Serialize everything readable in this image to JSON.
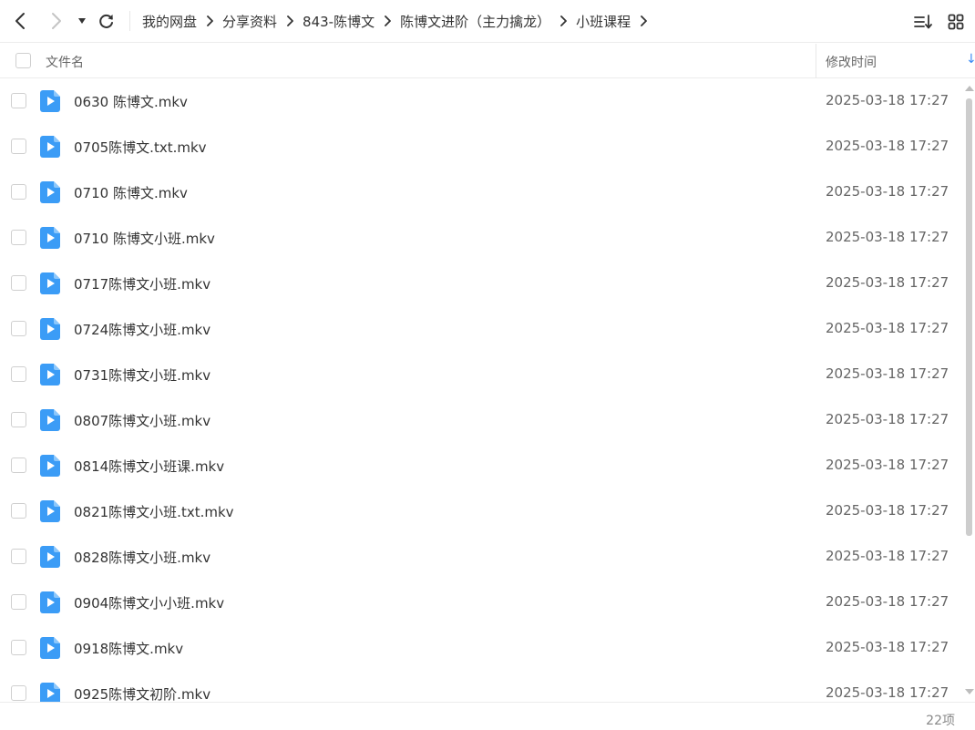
{
  "toolbar": {
    "back_icon": "chevron-left-icon",
    "forward_icon": "chevron-right-icon",
    "dropdown_icon": "caret-down-icon",
    "refresh_icon": "refresh-icon",
    "sort_icon": "sort-icon",
    "grid_icon": "grid-view-icon"
  },
  "breadcrumb": [
    "我的网盘",
    "分享资料",
    "843-陈博文",
    "陈博文进阶（主力擒龙）",
    "小班课程"
  ],
  "header": {
    "name_label": "文件名",
    "time_label": "修改时间",
    "sort_arrow": "↓"
  },
  "files": [
    {
      "name": "0630 陈博文.mkv",
      "time": "2025-03-18 17:27"
    },
    {
      "name": "0705陈博文.txt.mkv",
      "time": "2025-03-18 17:27"
    },
    {
      "name": "0710 陈博文.mkv",
      "time": "2025-03-18 17:27"
    },
    {
      "name": "0710 陈博文小班.mkv",
      "time": "2025-03-18 17:27"
    },
    {
      "name": "0717陈博文小班.mkv",
      "time": "2025-03-18 17:27"
    },
    {
      "name": "0724陈博文小班.mkv",
      "time": "2025-03-18 17:27"
    },
    {
      "name": "0731陈博文小班.mkv",
      "time": "2025-03-18 17:27"
    },
    {
      "name": "0807陈博文小班.mkv",
      "time": "2025-03-18 17:27"
    },
    {
      "name": "0814陈博文小班课.mkv",
      "time": "2025-03-18 17:27"
    },
    {
      "name": "0821陈博文小班.txt.mkv",
      "time": "2025-03-18 17:27"
    },
    {
      "name": "0828陈博文小班.mkv",
      "time": "2025-03-18 17:27"
    },
    {
      "name": "0904陈博文小小班.mkv",
      "time": "2025-03-18 17:27"
    },
    {
      "name": "0918陈博文.mkv",
      "time": "2025-03-18 17:27"
    },
    {
      "name": "0925陈博文初阶.mkv",
      "time": "2025-03-18 17:27"
    }
  ],
  "footer": {
    "item_count": "22项"
  },
  "colors": {
    "video_icon": "#3b9cf6",
    "accent": "#3b8cf5"
  }
}
